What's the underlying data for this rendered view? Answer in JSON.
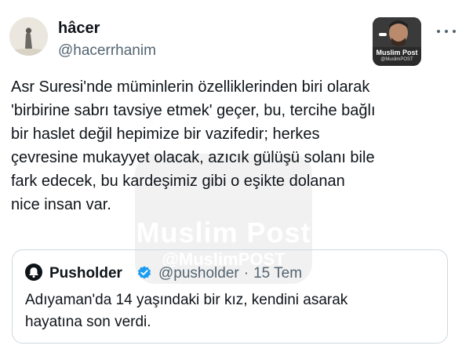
{
  "author": {
    "display_name": "hâcer",
    "handle": "@hacerrhanim"
  },
  "brand_badge": {
    "title": "Muslim Post",
    "handle": "@MuslimPOST"
  },
  "watermark": {
    "title": "Muslim Post",
    "handle": "@MuslimPOST"
  },
  "tweet": {
    "text": "Asr Suresi'nde müminlerin özelliklerinden biri olarak\n'birbirine sabrı tavsiye etmek' geçer, bu, tercihe bağlı\nbir haslet değil hepimize bir vazifedir; herkes\nçevresine mukayyet olacak, azıcık gülüşü solanı bile\nfark edecek, bu kardeşimiz gibi o eşikte dolanan\nnice insan var."
  },
  "quoted_tweet": {
    "display_name": "Pusholder",
    "handle": "@pusholder",
    "separator": "·",
    "date": "15 Tem",
    "text": "Adıyaman'da 14 yaşındaki bir kız, kendini asarak\nhayatına son verdi."
  },
  "icons": {
    "more": "more-horizontal-icon",
    "verified": "verified-badge-icon",
    "quote_avatar": "bell-logo-icon"
  },
  "colors": {
    "text": "#0f1419",
    "secondary": "#536471",
    "verified": "#1d9bf0",
    "border": "#cfd9de"
  }
}
